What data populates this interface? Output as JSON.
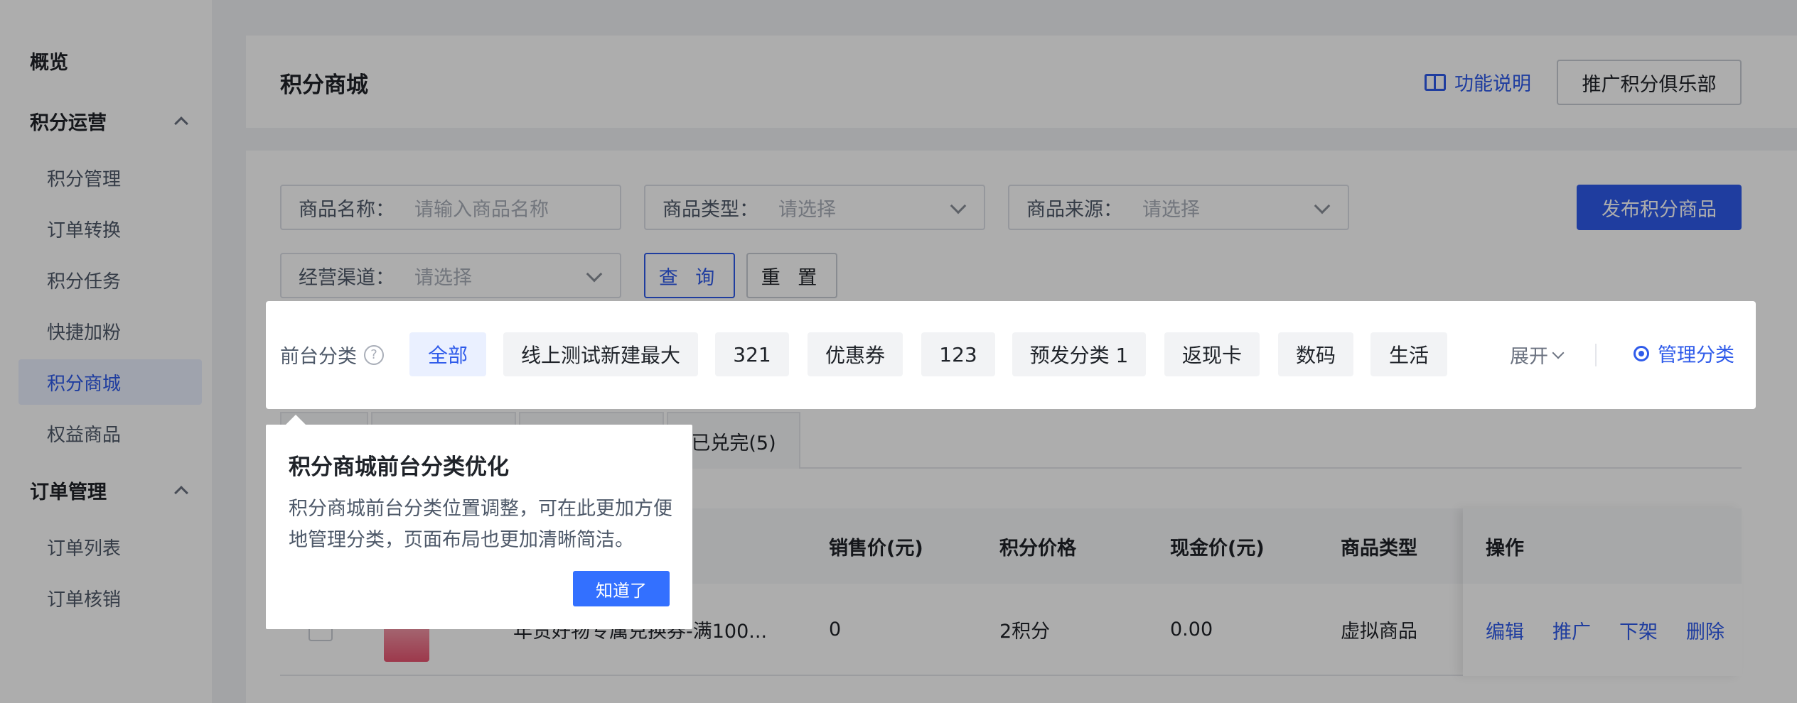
{
  "sidebar": {
    "overview": "概览",
    "groups": [
      {
        "label": "积分运营",
        "items": [
          "积分管理",
          "订单转换",
          "积分任务",
          "快捷加粉",
          "积分商城",
          "权益商品"
        ]
      },
      {
        "label": "订单管理",
        "items": [
          "订单列表",
          "订单核销"
        ]
      }
    ],
    "active_item": "积分商城"
  },
  "header": {
    "title": "积分商城",
    "help_link": "功能说明",
    "promo_button": "推广积分俱乐部"
  },
  "filters": {
    "name_label": "商品名称：",
    "name_placeholder": "请输入商品名称",
    "type_label": "商品类型：",
    "type_placeholder": "请选择",
    "source_label": "商品来源：",
    "source_placeholder": "请选择",
    "channel_label": "经营渠道：",
    "channel_placeholder": "请选择",
    "query_button": "查 询",
    "reset_button": "重 置",
    "publish_button": "发布积分商品"
  },
  "categories": {
    "label": "前台分类",
    "help_icon": "?",
    "chips": [
      "全部",
      "线上测试新建最大",
      "321",
      "优惠券",
      "123",
      "预发分类 1",
      "返现卡",
      "数码",
      "生活"
    ],
    "expand": "展开",
    "manage": "管理分类"
  },
  "tabs": {
    "items": [
      "",
      "",
      "",
      "已兑完(5)"
    ]
  },
  "table": {
    "columns": [
      "销售价(元)",
      "积分价格",
      "现金价(元)",
      "商品类型",
      "操作"
    ],
    "rows": [
      {
        "name": "年货好物专属兑换券-满100...",
        "price": "0",
        "points": "2积分",
        "cash": "0.00",
        "type": "虚拟商品"
      }
    ],
    "actions": [
      "编辑",
      "推广",
      "下架",
      "删除"
    ]
  },
  "popover": {
    "title": "积分商城前台分类优化",
    "body": "积分商城前台分类位置调整，可在此更加方便地管理分类，页面布局也更加清晰简洁。",
    "button": "知道了"
  },
  "colors": {
    "primary": "#2f5bea",
    "popover_button": "#3370ff"
  }
}
